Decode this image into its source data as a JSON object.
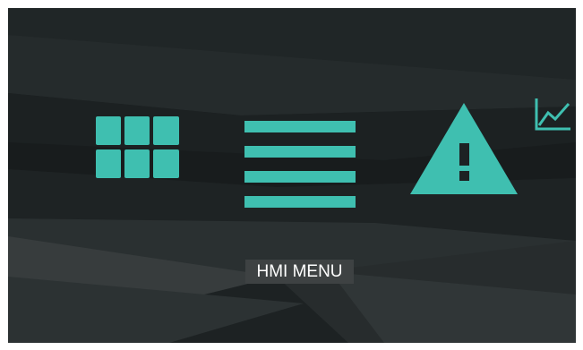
{
  "screen": {
    "menu_label": "HMI MENU"
  },
  "icons": {
    "grid": "grid-icon",
    "menu": "hamburger-menu-icon",
    "alert": "warning-triangle-icon",
    "trend": "trend-chart-icon"
  },
  "colors": {
    "accent": "#3fbfb0",
    "background": "#1d2223",
    "label_background": "#3e4243",
    "label_text": "#ffffff"
  }
}
